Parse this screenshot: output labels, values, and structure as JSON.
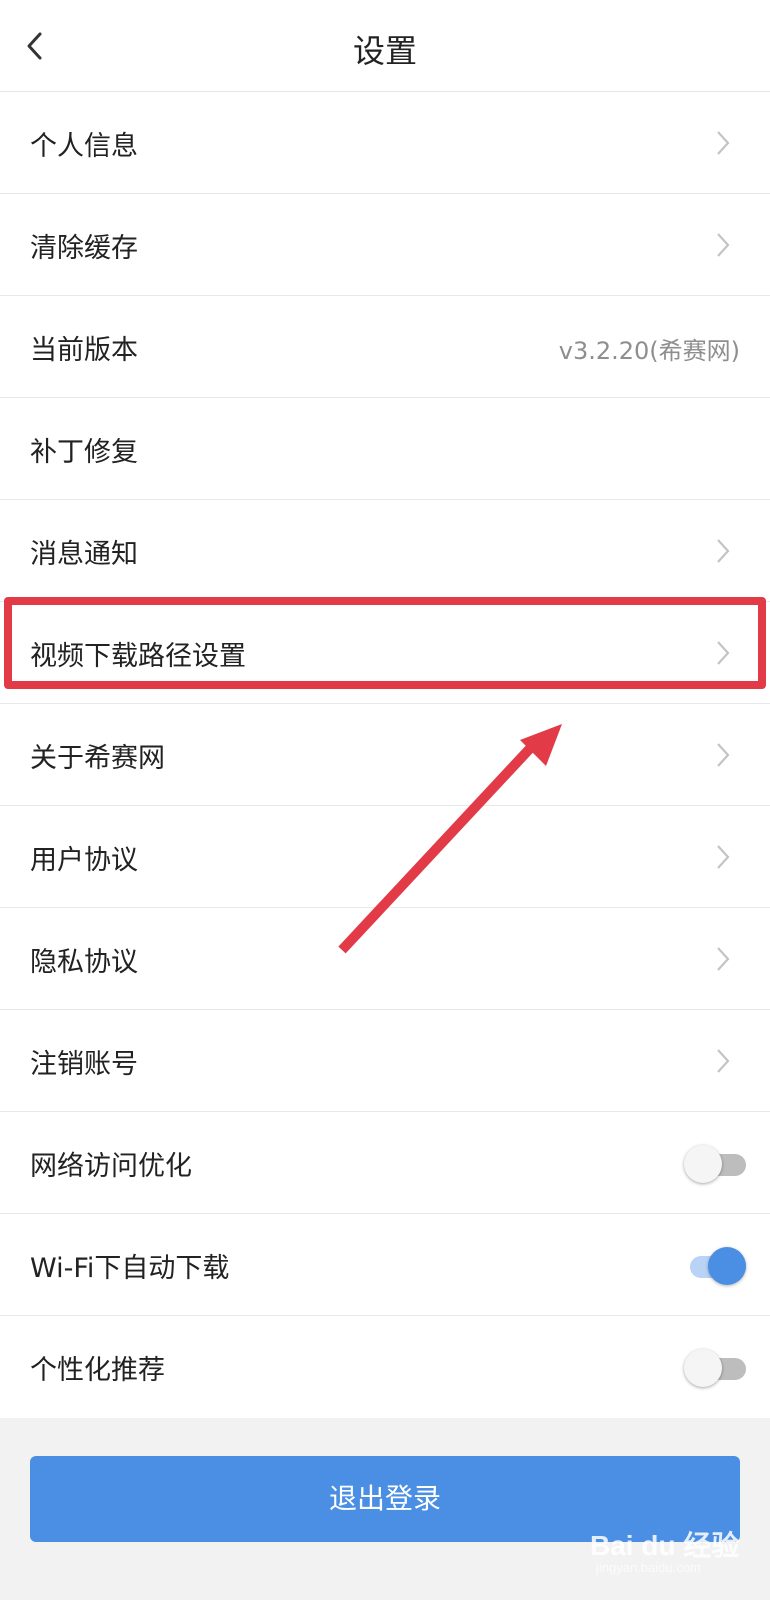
{
  "header": {
    "title": "设置",
    "back_icon": "chevron-left-icon"
  },
  "settings": [
    {
      "label": "个人信息",
      "type": "link"
    },
    {
      "label": "清除缓存",
      "type": "link"
    },
    {
      "label": "当前版本",
      "type": "value",
      "value": "v3.2.20(希赛网)"
    },
    {
      "label": "补丁修复",
      "type": "plain"
    },
    {
      "label": "消息通知",
      "type": "link"
    },
    {
      "label": "视频下载路径设置",
      "type": "link",
      "highlighted": true
    },
    {
      "label": "关于希赛网",
      "type": "link"
    },
    {
      "label": "用户协议",
      "type": "link"
    },
    {
      "label": "隐私协议",
      "type": "link"
    },
    {
      "label": "注销账号",
      "type": "link"
    },
    {
      "label": "网络访问优化",
      "type": "toggle",
      "on": false
    },
    {
      "label": "Wi-Fi下自动下载",
      "type": "toggle",
      "on": true
    },
    {
      "label": "个性化推荐",
      "type": "toggle",
      "on": false
    }
  ],
  "logout": {
    "label": "退出登录"
  },
  "watermark": {
    "text": "Bai du 经验",
    "sub": "jingyan.baidu.com"
  },
  "colors": {
    "accent": "#4a8fe3",
    "annotation": "#e23a47",
    "toggle_off_track": "#bdbdbd",
    "toggle_on_track": "#b8d3f5"
  }
}
